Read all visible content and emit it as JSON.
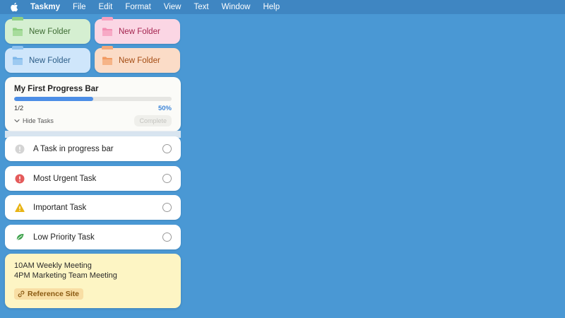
{
  "menubar": {
    "app_name": "Taskmy",
    "items": [
      "File",
      "Edit",
      "Format",
      "View",
      "Text",
      "Window",
      "Help"
    ]
  },
  "folders": [
    {
      "label": "New Folder",
      "color": "#8fce82"
    },
    {
      "label": "New Folder",
      "color": "#f6a0bf"
    },
    {
      "label": "New Folder",
      "color": "#8fc3ef"
    },
    {
      "label": "New Folder",
      "color": "#f4a979"
    }
  ],
  "progress": {
    "title": "My First Progress Bar",
    "count": "1/2",
    "percent_text": "50%",
    "fraction": 0.5,
    "hide_tasks_label": "Hide Tasks",
    "complete_label": "Complete",
    "accent": "#4c8ee6"
  },
  "tasks": [
    {
      "label": "A Task in progress bar",
      "icon": "exclamation-gray-icon"
    },
    {
      "label": "Most Urgent Task",
      "icon": "exclamation-red-icon"
    },
    {
      "label": "Important Task",
      "icon": "warning-triangle-icon"
    },
    {
      "label": "Low Priority Task",
      "icon": "leaf-icon"
    }
  ],
  "note": {
    "lines": [
      "10AM Weekly Meeting",
      "4PM Marketing Team Meeting"
    ],
    "link_label": "Reference Site"
  }
}
